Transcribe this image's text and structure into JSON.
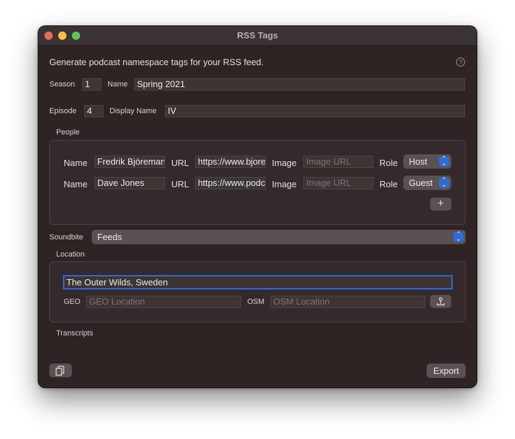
{
  "window": {
    "title": "RSS Tags"
  },
  "intro": "Generate podcast namespace tags for your RSS feed.",
  "season": {
    "label": "Season",
    "value": "1"
  },
  "season_name": {
    "label": "Name",
    "value": "Spring 2021"
  },
  "episode": {
    "label": "Episode",
    "value": "4"
  },
  "display_name": {
    "label": "Display Name",
    "value": "IV"
  },
  "people": {
    "heading": "People",
    "name_label": "Name",
    "url_label": "URL",
    "image_label": "Image",
    "role_label": "Role",
    "image_placeholder": "Image URL",
    "rows": [
      {
        "name": "Fredrik Björeman",
        "url": "https://www.bjoreman.com",
        "role": "Host"
      },
      {
        "name": "Dave Jones",
        "url": "https://www.podcastindex.org",
        "role": "Guest"
      }
    ],
    "add_label": "+"
  },
  "soundbite": {
    "label": "Soundbite",
    "value": "Feeds"
  },
  "location": {
    "heading": "Location",
    "value": "The Outer Wilds, Sweden",
    "geo_label": "GEO",
    "geo_placeholder": "GEO Location",
    "osm_label": "OSM",
    "osm_placeholder": "OSM Location"
  },
  "transcripts": {
    "heading": "Transcripts"
  },
  "footer": {
    "export_label": "Export"
  },
  "colors": {
    "accent": "#2f6bd6",
    "focus_ring": "#2f6bd6",
    "window_bg": "#2e2424"
  }
}
